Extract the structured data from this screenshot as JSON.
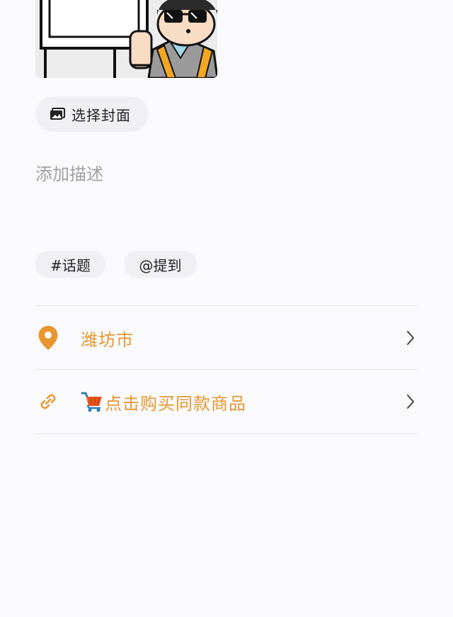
{
  "cover": {
    "choose_label": "选择封面"
  },
  "description": {
    "placeholder": "添加描述"
  },
  "tags": {
    "topic_label": "#话题",
    "mention_label": "@提到"
  },
  "location": {
    "label": "潍坊市"
  },
  "product_link": {
    "label": "点击购买同款商品"
  },
  "colors": {
    "accent": "#e8962d",
    "background": "#fafafc",
    "chip_bg": "#f0f0f3"
  },
  "icons": [
    "image-icon",
    "location-pin-icon",
    "link-icon",
    "cart-icon",
    "chevron-right-icon"
  ]
}
